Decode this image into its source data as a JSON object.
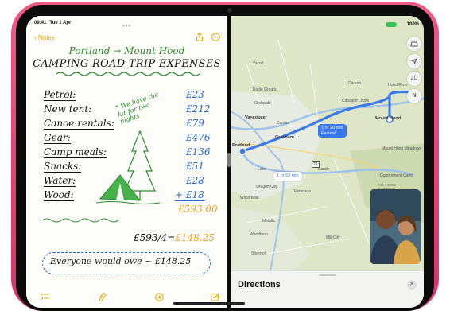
{
  "notes": {
    "status_time": "09:41",
    "status_date": "Tue 1 Apr",
    "back_label": "Notes",
    "title_route": "Portland → Mount Hood",
    "title_main": "CAMPING ROAD TRIP EXPENSES",
    "side_note": "* We have the kit for two nights",
    "items": [
      {
        "label": "Petrol:",
        "price": "£23"
      },
      {
        "label": "New tent:",
        "price": "£212"
      },
      {
        "label": "Canoe rentals:",
        "price": "£79"
      },
      {
        "label": "Gear:",
        "price": "£476"
      },
      {
        "label": "Camp meals:",
        "price": "£136"
      },
      {
        "label": "Snacks:",
        "price": "£51"
      },
      {
        "label": "Water:",
        "price": "£28"
      },
      {
        "label": "Wood:",
        "price": "+ £18"
      }
    ],
    "total": "£593.00",
    "calc_lhs": "£593/4=",
    "calc_rhs": "£148.25",
    "owe_text": "Everyone would owe ~ £148.25",
    "icons": {
      "share": "share-icon",
      "more": "more-icon",
      "checklist": "checklist-icon",
      "attach": "paperclip-icon",
      "pen": "pen-icon",
      "compose": "compose-icon"
    }
  },
  "map": {
    "status_text": "100%",
    "labels": {
      "portland": "Portland",
      "vancouver": "Vancouver",
      "gresham": "Gresham",
      "camas": "Camas",
      "orchards": "Orchards",
      "battle_ground": "Battle Ground",
      "mount_hood": "Mount Hood",
      "cascade_locks": "Cascade Locks",
      "carson": "Carson",
      "hood_river": "Hood River",
      "sandy": "Sandy",
      "oregon_city": "Oregon City",
      "lake_oswego": "Lake",
      "estacada": "Estacada",
      "wilsonville": "Wilsonville",
      "molalla": "Molalla",
      "silverton": "Silverton",
      "yacolt": "Yacolt",
      "mt_hood_forest": "MT. HOOD NATIONAL FOREST",
      "government_camp": "Government Camp",
      "mount_hood_resort": "Mount Hood Meadows",
      "mill_city": "Mill City",
      "woodburn": "Woodburn",
      "highway_number": "26"
    },
    "route_primary": {
      "time": "1 hr 20 min",
      "tag": "Fastest"
    },
    "route_alt": {
      "time": "1 hr 53 min"
    },
    "buttons": {
      "drive": "car-icon",
      "locate": "location-arrow-icon",
      "view": "2D",
      "compass": "N"
    },
    "directions_title": "Directions",
    "close_label": "✕"
  },
  "colors": {
    "case": "#e83d72",
    "route": "#3a78e7",
    "notes_accent": "#e0a800",
    "green_ink": "#2e8a2e",
    "blue_ink": "#2a67d6",
    "orange_ink": "#f0a020"
  }
}
